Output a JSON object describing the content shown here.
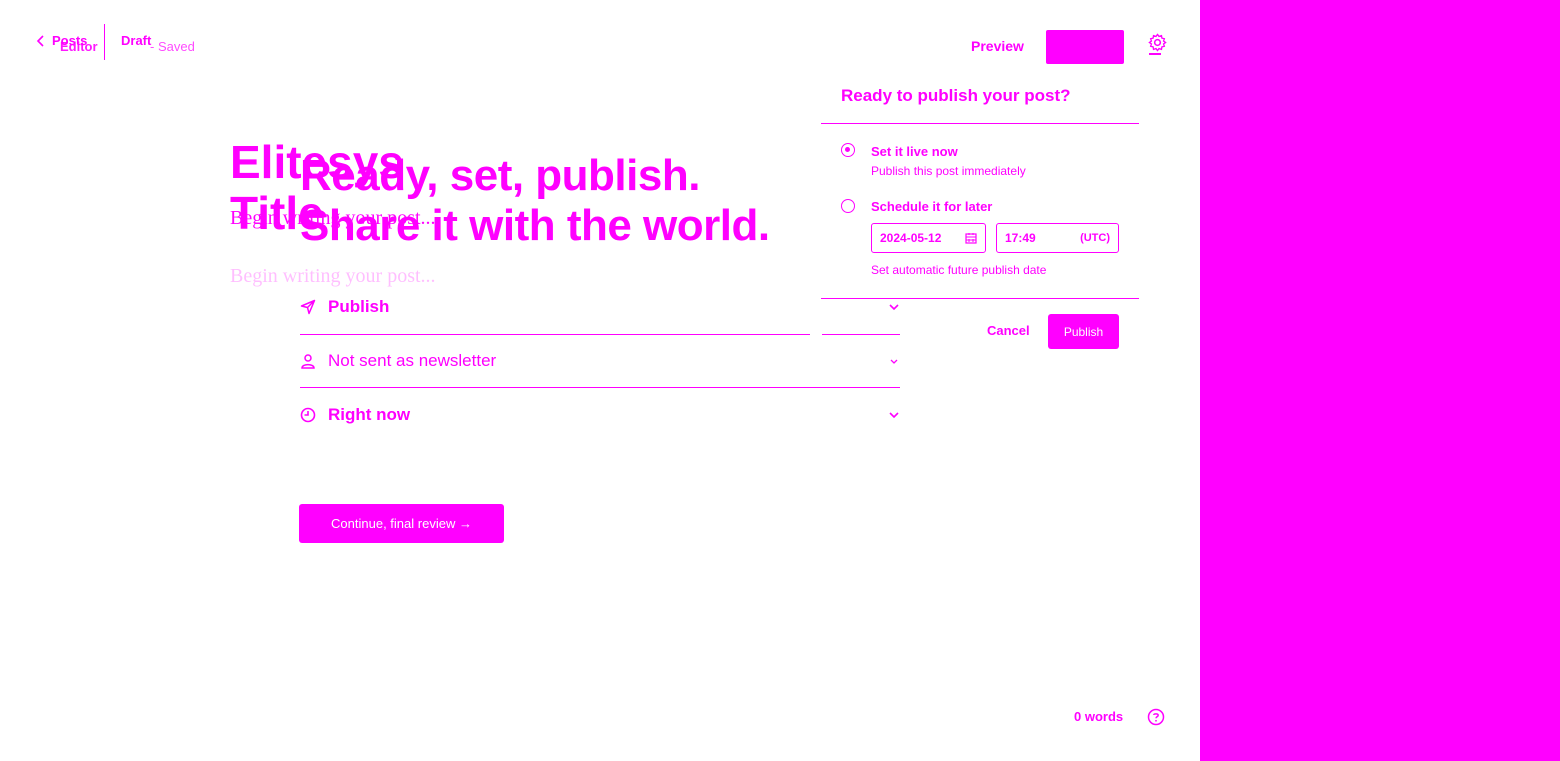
{
  "header": {
    "back_label": "Posts",
    "editor_label": "Editor",
    "status": "Draft",
    "saved_text": "- Saved",
    "preview_label": "Preview"
  },
  "editor": {
    "title_line1": "Elitesys",
    "title_line2": "Title",
    "subtitle": "Begin writing your post...",
    "body_placeholder": "Begin writing your post..."
  },
  "publish_flow": {
    "heading_line1": "Ready, set, publish.",
    "heading_line2": "Share it with the world.",
    "rows": [
      {
        "label": "Publish",
        "icon": "send-icon"
      },
      {
        "label": "Not sent as newsletter",
        "icon": "person-icon"
      },
      {
        "label": "Right now",
        "icon": "clock-icon"
      }
    ],
    "continue_label": "Continue, final review →"
  },
  "popover": {
    "title": "Ready to publish your post?",
    "option_now_title": "Set it live now",
    "option_now_desc": "Publish this post immediately",
    "option_later_title": "Schedule it for later",
    "date_value": "2024-05-12",
    "time_value": "17:49",
    "tz_label": "(UTC)",
    "later_desc": "Set automatic future publish date",
    "cancel_label": "Cancel",
    "publish_label": "Publish"
  },
  "footer": {
    "word_count": "0 words"
  },
  "colors": {
    "accent": "#ff00ff",
    "background": "#ffffff"
  }
}
